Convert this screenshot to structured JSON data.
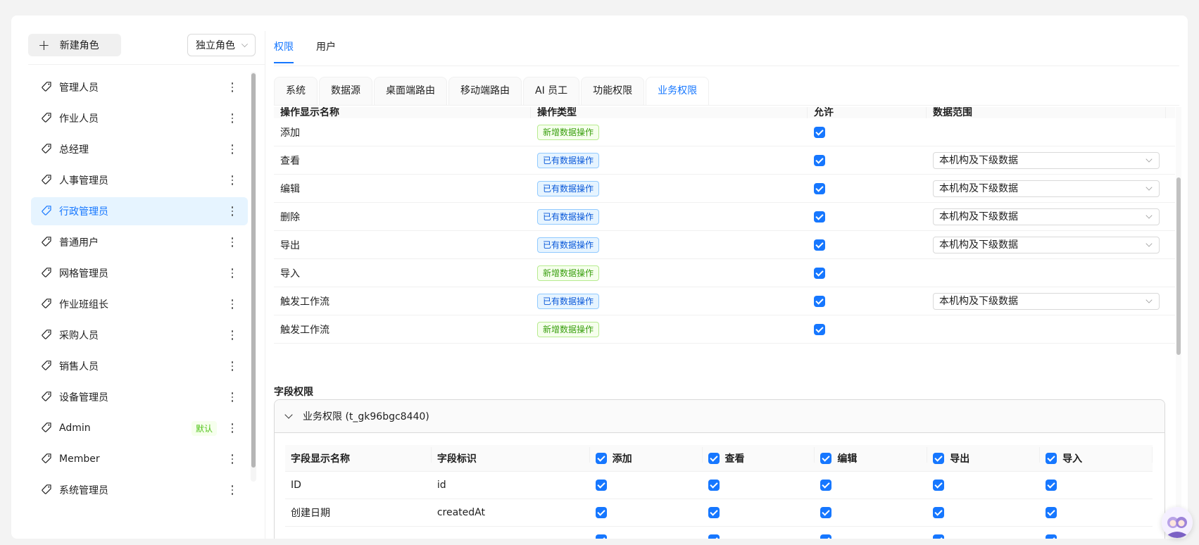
{
  "left_panel": {
    "new_role_label": "新建角色",
    "role_mode": "独立角色",
    "roles": [
      {
        "label": "管理人员"
      },
      {
        "label": "作业人员"
      },
      {
        "label": "总经理"
      },
      {
        "label": "人事管理员"
      },
      {
        "label": "行政管理员",
        "active": true
      },
      {
        "label": "普通用户"
      },
      {
        "label": "网格管理员"
      },
      {
        "label": "作业班组长"
      },
      {
        "label": "采购人员"
      },
      {
        "label": "销售人员"
      },
      {
        "label": "设备管理员"
      },
      {
        "label": "Admin",
        "badge": "默认"
      },
      {
        "label": "Member"
      },
      {
        "label": "系统管理员"
      }
    ]
  },
  "top_tabs": [
    {
      "label": "权限",
      "active": true
    },
    {
      "label": "用户"
    }
  ],
  "sub_tabs": [
    {
      "label": "系统"
    },
    {
      "label": "数据源"
    },
    {
      "label": "桌面端路由"
    },
    {
      "label": "移动端路由"
    },
    {
      "label": "AI 员工"
    },
    {
      "label": "功能权限"
    },
    {
      "label": "业务权限",
      "active": true
    }
  ],
  "op_table": {
    "headers": [
      "操作显示名称",
      "操作类型",
      "允许",
      "数据范围"
    ],
    "rows": [
      {
        "name": "添加",
        "type": "新增数据操作",
        "type_kind": "new",
        "allowed": true,
        "scope": ""
      },
      {
        "name": "查看",
        "type": "已有数据操作",
        "type_kind": "exist",
        "allowed": true,
        "scope": "本机构及下级数据"
      },
      {
        "name": "编辑",
        "type": "已有数据操作",
        "type_kind": "exist",
        "allowed": true,
        "scope": "本机构及下级数据"
      },
      {
        "name": "删除",
        "type": "已有数据操作",
        "type_kind": "exist",
        "allowed": true,
        "scope": "本机构及下级数据"
      },
      {
        "name": "导出",
        "type": "已有数据操作",
        "type_kind": "exist",
        "allowed": true,
        "scope": "本机构及下级数据"
      },
      {
        "name": "导入",
        "type": "新增数据操作",
        "type_kind": "new",
        "allowed": true,
        "scope": ""
      },
      {
        "name": "触发工作流",
        "type": "已有数据操作",
        "type_kind": "exist",
        "allowed": true,
        "scope": "本机构及下级数据"
      },
      {
        "name": "触发工作流",
        "type": "新增数据操作",
        "type_kind": "new",
        "allowed": true,
        "scope": ""
      }
    ]
  },
  "field_permissions": {
    "title": "字段权限",
    "collapse_title": "业务权限 (t_gk96bgc8440)",
    "headers": {
      "name": "字段显示名称",
      "key": "字段标识",
      "ops": [
        "添加",
        "查看",
        "编辑",
        "导出",
        "导入"
      ]
    },
    "rows": [
      {
        "name": "ID",
        "key": "id"
      },
      {
        "name": "创建日期",
        "key": "createdAt"
      }
    ]
  },
  "colors": {
    "accent": "#1677ff",
    "active_bg": "#e6f4ff",
    "new_tag": "#389e0d",
    "exist_tag": "#0958d9"
  }
}
